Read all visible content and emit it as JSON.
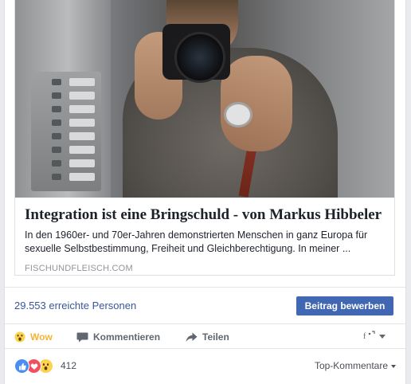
{
  "link_preview": {
    "title": "Integration ist eine Bringschuld - von Markus Hibbeler",
    "description": "In den 1960er- und 70er-Jahren demonstrierten Menschen in ganz Europa für sexuelle Selbstbestimmung, Freiheit und Gleichberechtigung. In meiner ...",
    "domain": "FISCHUNDFLEISCH.COM"
  },
  "insights": {
    "reach_text": "29.553 erreichte Personen",
    "boost_label": "Beitrag bewerben"
  },
  "actions": {
    "wow_label": "Wow",
    "comment_label": "Kommentieren",
    "share_label": "Teilen"
  },
  "reactions": {
    "count": "412",
    "types": [
      "like-icon",
      "love-icon",
      "wow-icon"
    ]
  },
  "comments": {
    "sort_label": "Top-Kommentare"
  },
  "colors": {
    "link_blue": "#365899",
    "button_blue": "#4267b2",
    "wow_yellow": "#f5b333"
  }
}
